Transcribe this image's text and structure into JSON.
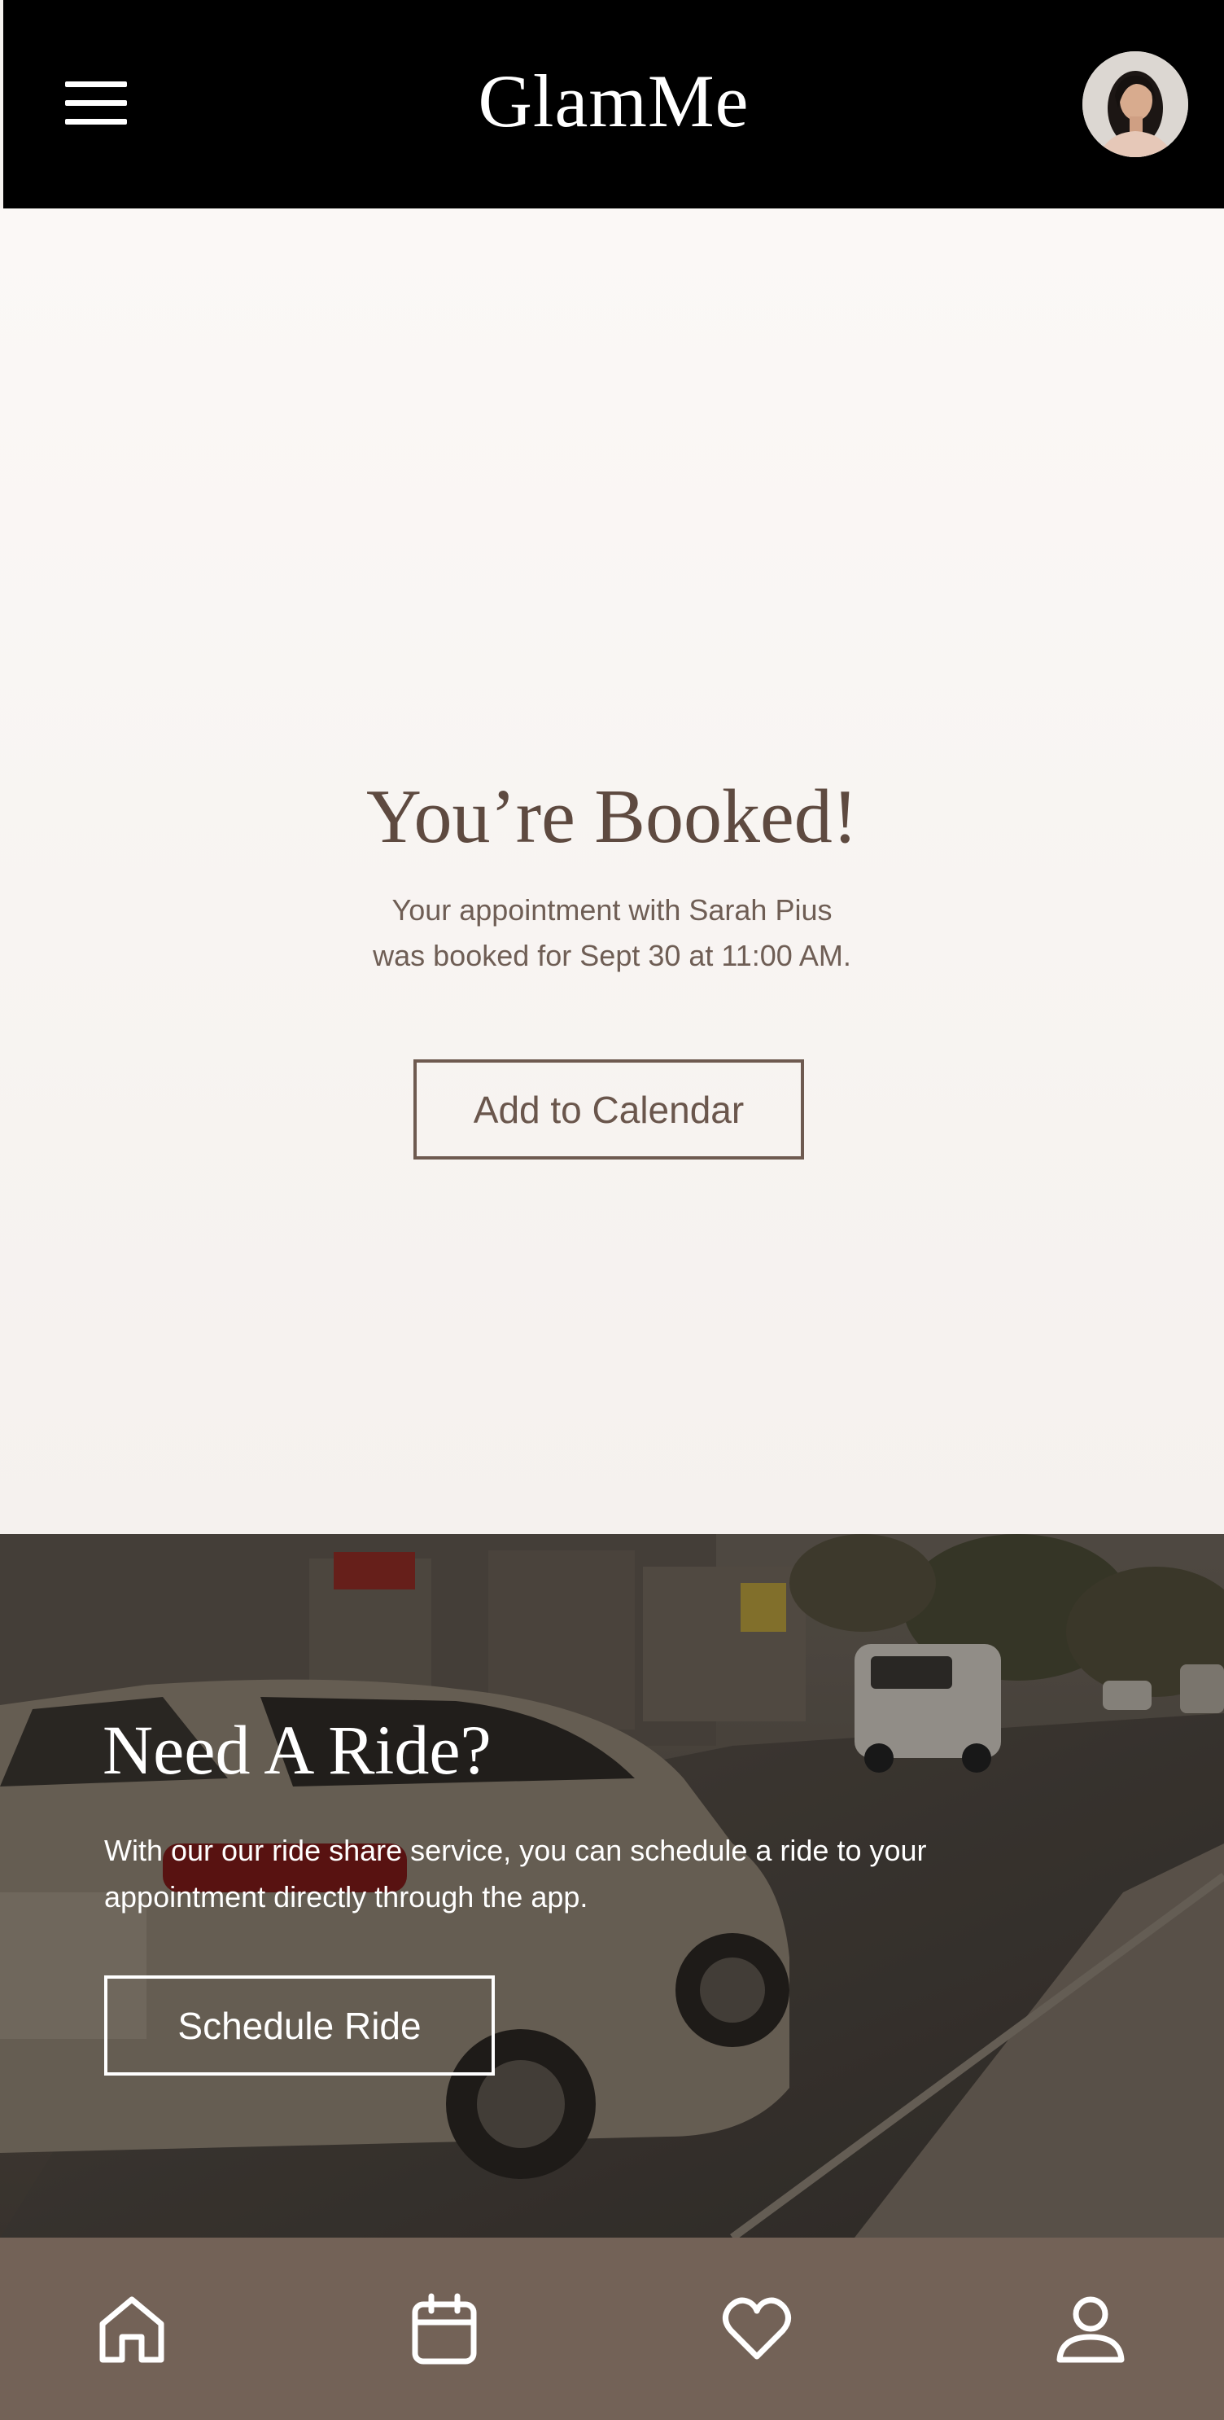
{
  "header": {
    "brand": "GlamMe"
  },
  "confirmation": {
    "title": "You’re Booked!",
    "message_line1": "Your appointment with Sarah Pius",
    "message_line2": "was booked for Sept 30 at 11:00 AM.",
    "calendar_button": "Add to Calendar"
  },
  "ride": {
    "title": "Need A Ride?",
    "description": "With our our ride share service, you can schedule a ride to your appointment directly through the app.",
    "button": "Schedule Ride"
  },
  "bottom_nav": {
    "items": [
      {
        "icon": "home-icon"
      },
      {
        "icon": "calendar-icon"
      },
      {
        "icon": "heart-icon"
      },
      {
        "icon": "profile-icon"
      }
    ]
  },
  "colors": {
    "header_bg": "#000000",
    "page_bg": "#f6f2ef",
    "accent_brown": "#5e4a40",
    "nav_bg": "#736257"
  }
}
